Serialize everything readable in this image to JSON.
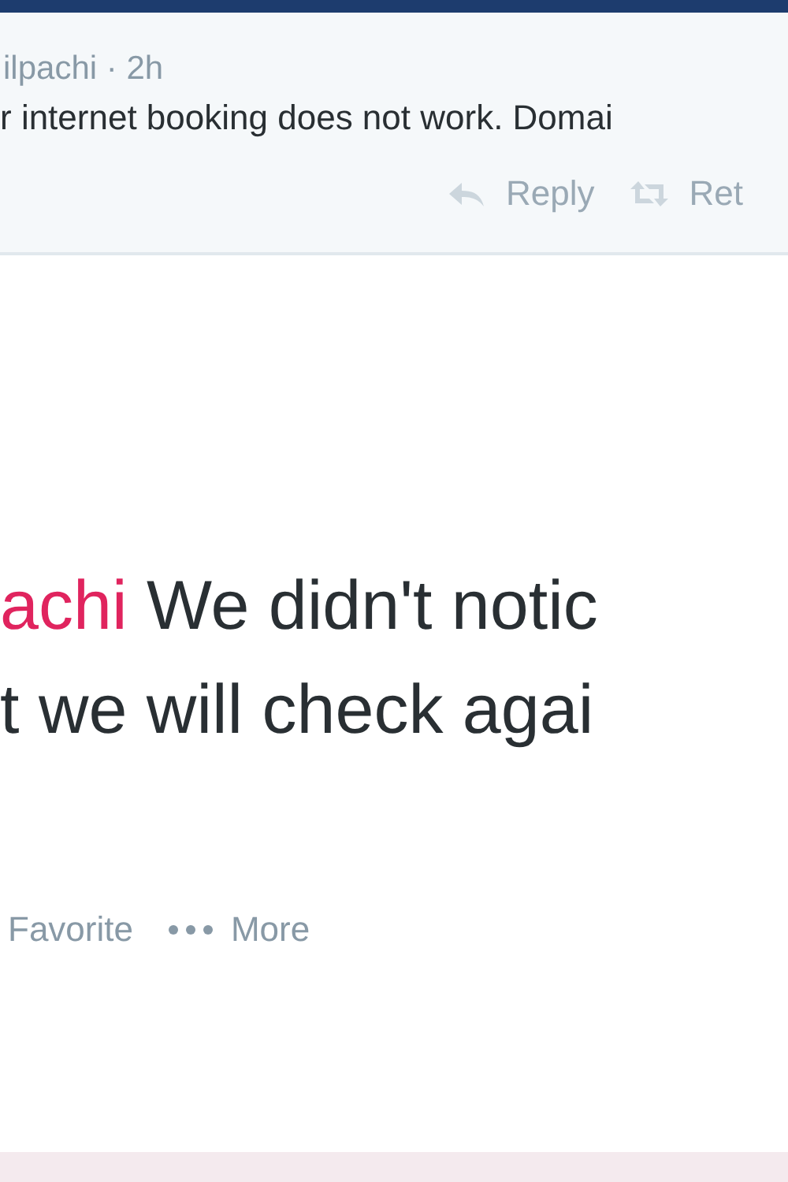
{
  "parent_tweet": {
    "author": "ilpachi",
    "separator": "·",
    "time": "2h",
    "text": "r internet booking does not work. Domai",
    "actions": [
      {
        "kind": "reply",
        "label": "Reply"
      },
      {
        "kind": "retweet",
        "label": "Ret"
      }
    ]
  },
  "reply_tweet": {
    "mention": "achi",
    "text_line_1": "We didn't notic",
    "text_line_2": "t we will check agai",
    "actions": [
      {
        "kind": "favorite",
        "label": "Favorite"
      },
      {
        "kind": "more",
        "label": "More"
      }
    ]
  }
}
